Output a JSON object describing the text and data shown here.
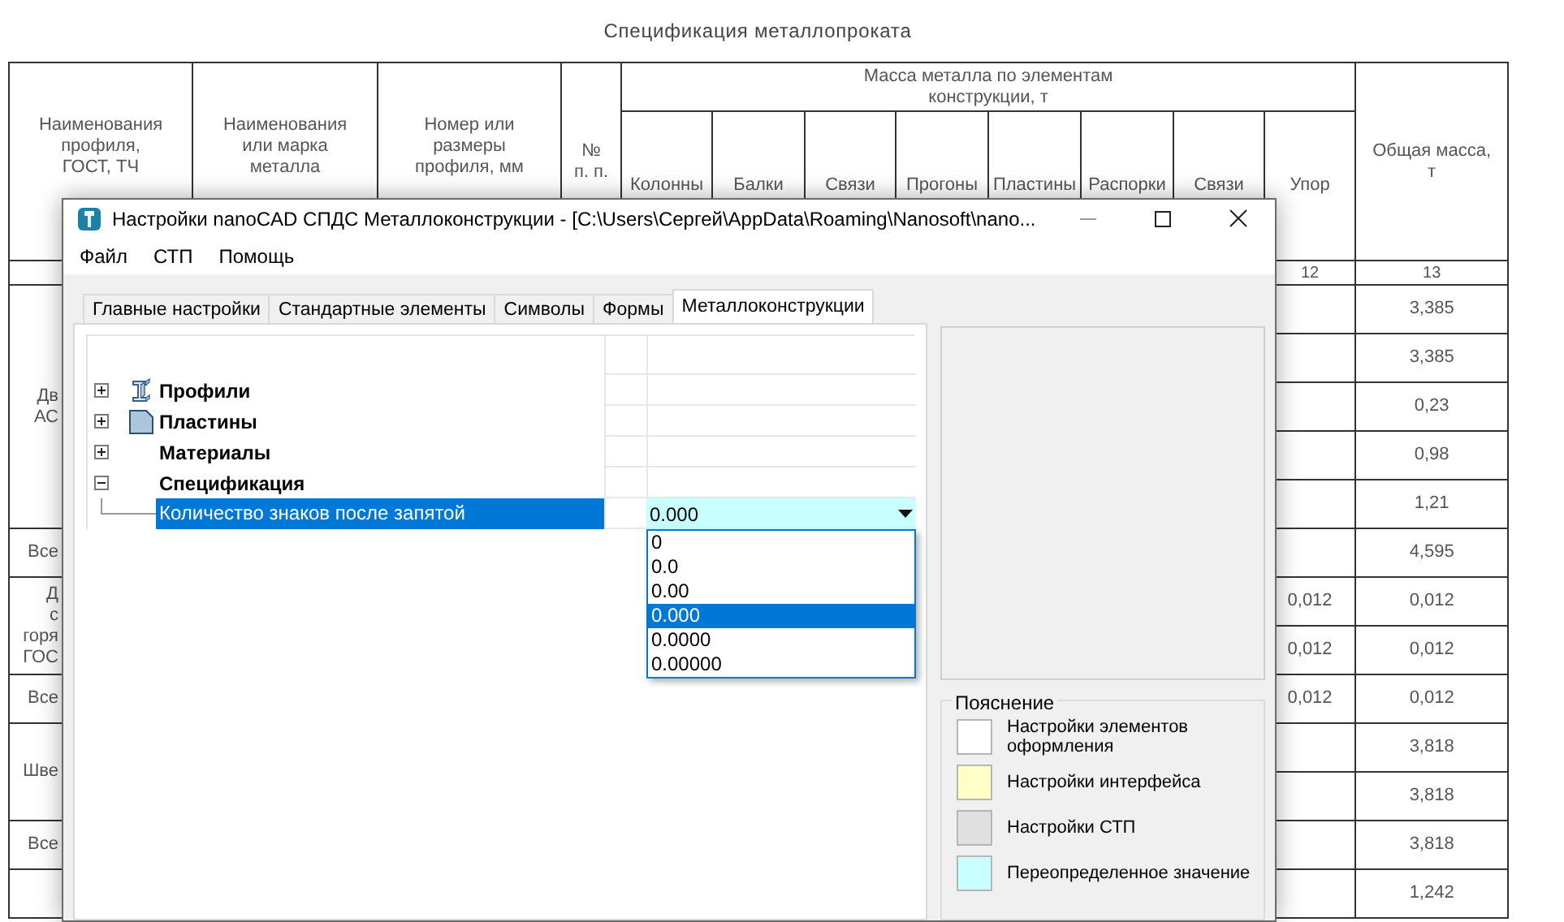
{
  "sheet": {
    "title": "Спецификация металлопроката",
    "columns": [
      {
        "lines": [
          "Наименования",
          "профиля,",
          "ГОСТ, ТЧ"
        ]
      },
      {
        "lines": [
          "Наименования",
          "или марка",
          "металла"
        ]
      },
      {
        "lines": [
          "Номер или",
          "размеры",
          "профиля, мм"
        ]
      },
      {
        "lines": [
          "№",
          "п. п."
        ]
      }
    ],
    "group_heading": {
      "lines": [
        "Масса металла по элементам",
        "конструкции, т"
      ]
    },
    "sub_columns": [
      "Колонны",
      "Балки",
      "Связи",
      "Прогоны",
      "Пластины",
      "Распорки",
      "Связи",
      "Упор"
    ],
    "total_column": {
      "lines": [
        "Общая масса,",
        "т"
      ]
    },
    "column_numbers": {
      "upor": "12",
      "total": "13"
    },
    "groups": [
      {
        "name": [
          "Дв",
          "АС"
        ],
        "rows": [
          {
            "total": "3,385"
          },
          {
            "total": "3,385"
          },
          {
            "total": "0,23"
          },
          {
            "total": "0,98"
          },
          {
            "total": "1,21"
          }
        ]
      },
      {
        "name": [
          "Все"
        ],
        "rows": [
          {
            "total": "4,595"
          }
        ]
      },
      {
        "name": [
          "Д",
          "с",
          "горя",
          "ГОС"
        ],
        "rows": [
          {
            "upor": "0,012",
            "total": "0,012"
          },
          {
            "upor": "0,012",
            "total": "0,012"
          }
        ]
      },
      {
        "name": [
          "Все"
        ],
        "rows": [
          {
            "upor": "0,012",
            "total": "0,012"
          }
        ]
      },
      {
        "name": [
          "Шве"
        ],
        "rows": [
          {
            "total": "3,818"
          },
          {
            "total": "3,818"
          }
        ]
      },
      {
        "name": [
          "Все"
        ],
        "rows": [
          {
            "total": "3,818"
          }
        ]
      },
      {
        "rows": [
          {
            "total": "1,242"
          }
        ]
      }
    ]
  },
  "dialog": {
    "title": "Настройки nanoCAD СПДС Металлоконструкции - [C:\\Users\\Сергей\\AppData\\Roaming\\Nanosoft\\nano...",
    "menu": [
      "Файл",
      "СТП",
      "Помощь"
    ],
    "tabs": [
      {
        "label": "Главные настройки",
        "selected": false
      },
      {
        "label": "Стандартные элементы",
        "selected": false
      },
      {
        "label": "Символы",
        "selected": false
      },
      {
        "label": "Формы",
        "selected": false
      },
      {
        "label": "Металлоконструкции",
        "selected": true
      }
    ],
    "tree": [
      {
        "label": "Профили",
        "kind": "beam",
        "expanded": false
      },
      {
        "label": "Пластины",
        "kind": "plate",
        "expanded": false
      },
      {
        "label": "Материалы",
        "kind": "plain",
        "expanded": false
      },
      {
        "label": "Спецификация",
        "kind": "plain",
        "expanded": true,
        "children": [
          {
            "label": "Количество знаков после запятой",
            "selected": true,
            "value": "0.000",
            "overridden": true,
            "options": [
              {
                "label": "0",
                "selected": false
              },
              {
                "label": "0.0",
                "selected": false
              },
              {
                "label": "0.00",
                "selected": false
              },
              {
                "label": "0.000",
                "selected": true
              },
              {
                "label": "0.0000",
                "selected": false
              },
              {
                "label": "0.00000",
                "selected": false
              }
            ]
          }
        ]
      }
    ],
    "legend": {
      "title": "Пояснение",
      "items": [
        {
          "label": "Настройки элементов оформления",
          "color": "#ffffff"
        },
        {
          "label": "Настройки интерфейса",
          "color": "#ffffc8"
        },
        {
          "label": "Настройки СТП",
          "color": "#e0e0e0"
        },
        {
          "label": "Переопределенное значение",
          "color": "#c8ffff"
        }
      ]
    }
  }
}
